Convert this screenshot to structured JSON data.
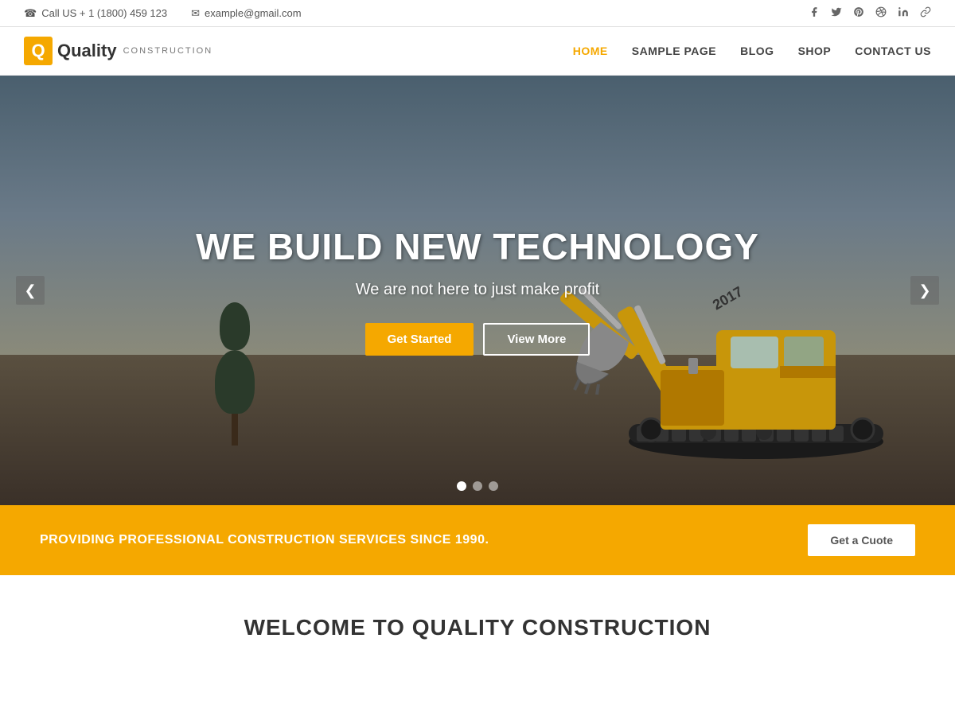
{
  "topbar": {
    "phone_icon": "☎",
    "phone_text": "Call US + 1 (1800) 459 123",
    "email_icon": "✉",
    "email_text": "example@gmail.com",
    "social_icons": [
      {
        "name": "facebook-icon",
        "glyph": "f"
      },
      {
        "name": "twitter-icon",
        "glyph": "t"
      },
      {
        "name": "pinterest-icon",
        "glyph": "p"
      },
      {
        "name": "dribbble-icon",
        "glyph": "d"
      },
      {
        "name": "linkedin-icon",
        "glyph": "in"
      },
      {
        "name": "chain-icon",
        "glyph": "🔗"
      }
    ]
  },
  "header": {
    "logo_letter": "Q",
    "logo_brand": "Quality",
    "logo_sub": "CONSTRUCTION",
    "nav_items": [
      {
        "label": "HOME",
        "active": true
      },
      {
        "label": "SAMPLE PAGE",
        "active": false
      },
      {
        "label": "BLOG",
        "active": false
      },
      {
        "label": "SHOP",
        "active": false
      },
      {
        "label": "CONTACT US",
        "active": false
      }
    ]
  },
  "hero": {
    "title": "WE BUILD NEW TECHNOLOGY",
    "subtitle": "We are not here to just make profit",
    "btn_primary": "Get Started",
    "btn_secondary": "View More",
    "arrow_left": "❮",
    "arrow_right": "❯",
    "dots": [
      true,
      false,
      false
    ]
  },
  "banner": {
    "text": "PROVIDING PROFESSIONAL CONSTRUCTION SERVICES SINCE 1990.",
    "btn_label": "Get a Cuote"
  },
  "welcome": {
    "title": "WELCOME TO QUALITY CONSTRUCTION"
  }
}
